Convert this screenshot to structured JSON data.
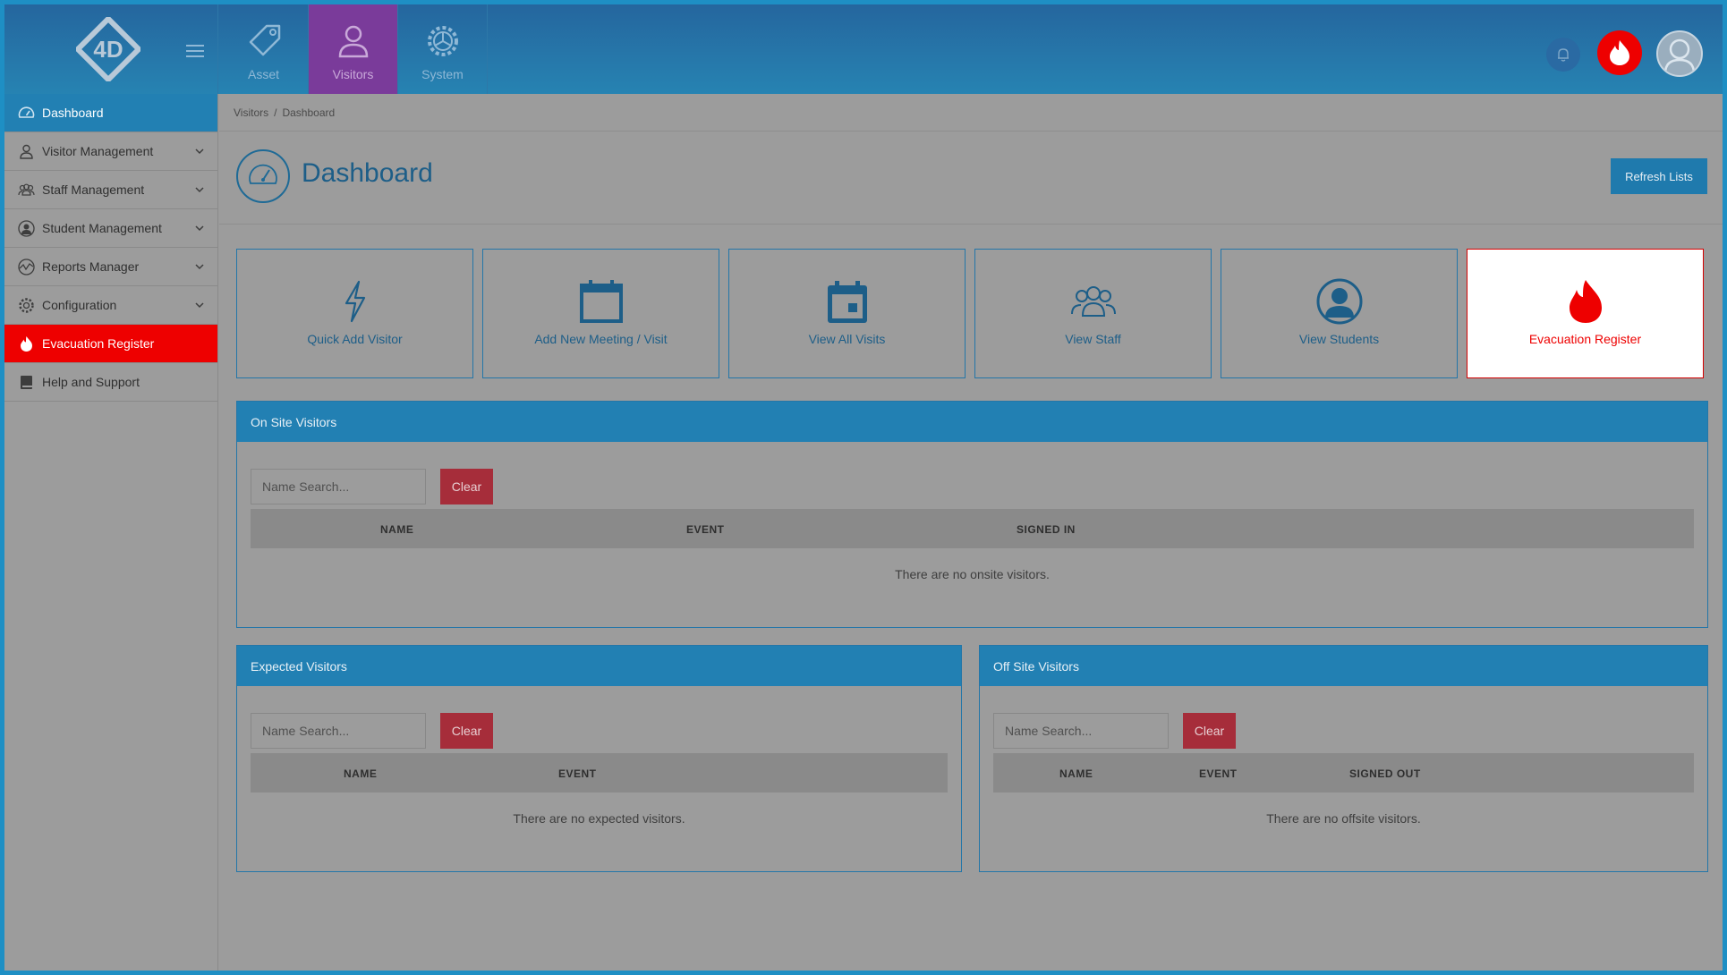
{
  "header": {
    "logo_text": "4D",
    "modules": [
      {
        "label": "Asset",
        "icon": "tag-icon",
        "active": false
      },
      {
        "label": "Visitors",
        "icon": "person-icon",
        "active": true
      },
      {
        "label": "System",
        "icon": "gear-icon",
        "active": false
      }
    ],
    "icons": [
      "bell-icon",
      "fire-icon",
      "user-avatar-icon"
    ]
  },
  "sidebar": {
    "items": [
      {
        "label": "Dashboard",
        "icon": "speedometer-icon",
        "state": "active",
        "expandable": false
      },
      {
        "label": "Visitor Management",
        "icon": "person-icon",
        "state": "normal",
        "expandable": true
      },
      {
        "label": "Staff Management",
        "icon": "group-icon",
        "state": "normal",
        "expandable": true
      },
      {
        "label": "Student Management",
        "icon": "student-icon",
        "state": "normal",
        "expandable": true
      },
      {
        "label": "Reports Manager",
        "icon": "chart-wave-icon",
        "state": "normal",
        "expandable": true
      },
      {
        "label": "Configuration",
        "icon": "gear-icon",
        "state": "normal",
        "expandable": true
      },
      {
        "label": "Evacuation Register",
        "icon": "fire-icon",
        "state": "alert",
        "expandable": false
      },
      {
        "label": "Help and Support",
        "icon": "book-icon",
        "state": "normal",
        "expandable": false
      }
    ]
  },
  "breadcrumb": {
    "items": [
      "Visitors",
      "Dashboard"
    ],
    "separator": "/"
  },
  "page": {
    "title": "Dashboard",
    "refresh_label": "Refresh Lists"
  },
  "tiles": [
    {
      "label": "Quick Add Visitor",
      "icon": "lightning-icon"
    },
    {
      "label": "Add New Meeting / Visit",
      "icon": "calendar-icon"
    },
    {
      "label": "View All Visits",
      "icon": "calendar-day-icon"
    },
    {
      "label": "View Staff",
      "icon": "group-icon"
    },
    {
      "label": "View Students",
      "icon": "student-icon"
    },
    {
      "label": "Evacuation Register",
      "icon": "fire-icon"
    }
  ],
  "panels": {
    "onsite": {
      "title": "On Site Visitors",
      "search_placeholder": "Name Search...",
      "clear_label": "Clear",
      "columns": [
        "NAME",
        "EVENT",
        "SIGNED IN"
      ],
      "empty_text": "There are no onsite visitors."
    },
    "expected": {
      "title": "Expected Visitors",
      "search_placeholder": "Name Search...",
      "clear_label": "Clear",
      "columns": [
        "NAME",
        "EVENT"
      ],
      "empty_text": "There are no expected visitors."
    },
    "offsite": {
      "title": "Off Site Visitors",
      "search_placeholder": "Name Search...",
      "clear_label": "Clear",
      "columns": [
        "NAME",
        "EVENT",
        "SIGNED OUT"
      ],
      "empty_text": "There are no offsite visitors."
    }
  },
  "colors": {
    "brand_blue": "#2280b3",
    "alert_red": "#ee0000",
    "clear_button": "#a62d3a",
    "active_module": "#7a3b9a",
    "overlay_gray": "#9c9c9c"
  }
}
